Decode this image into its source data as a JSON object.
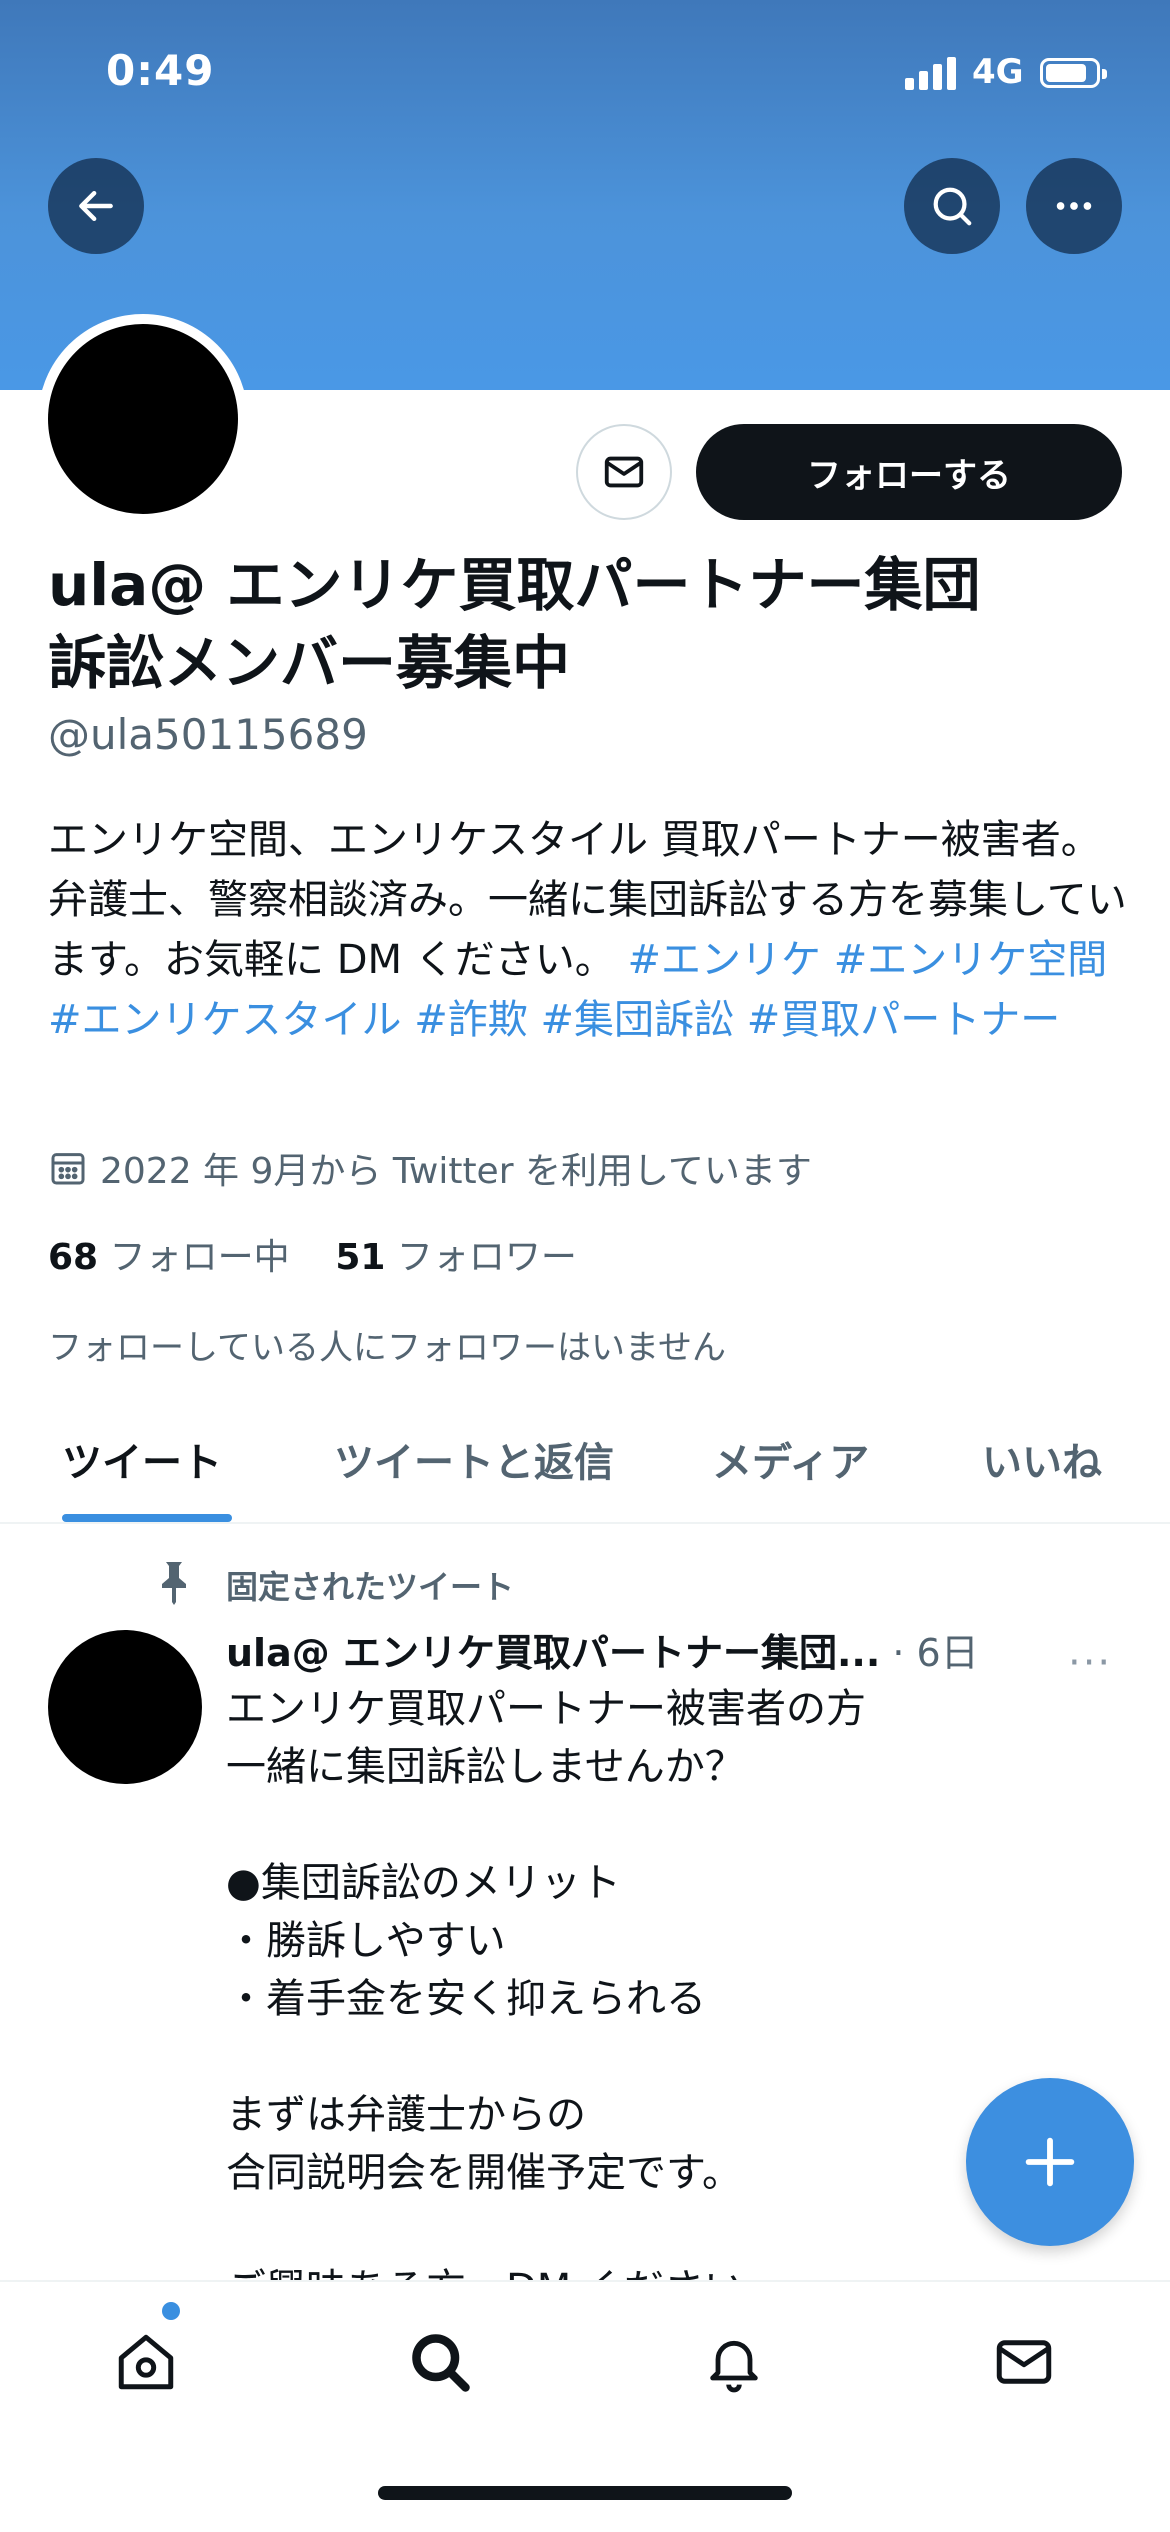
{
  "status_bar": {
    "time": "0:49",
    "network": "4G"
  },
  "header": {
    "back_icon": "arrow-left-icon",
    "search_icon": "search-icon",
    "more_icon": "more-horizontal-icon"
  },
  "profile": {
    "display_name": "ula@ エンリケ買取パートナー集団訴訟メンバー募集中",
    "handle": "@ula50115689",
    "bio_text": "エンリケ空間、エンリケスタイル 買取パートナー被害者。弁護士、警察相談済み。一緒に集団訴訟する方を募集しています。お気軽に DM ください。 ",
    "hashtags": [
      "#エンリケ",
      "#エンリケ空間",
      "#エンリケスタイル",
      "#詐欺",
      "#集団訴訟",
      "#買取パートナー"
    ],
    "joined": "2022 年 9月から Twitter を利用しています",
    "following_count": "68",
    "following_label": "フォロー中",
    "followers_count": "51",
    "followers_label": "フォロワー",
    "followers_note": "フォローしている人にフォロワーはいません",
    "follow_button": "フォローする",
    "dm_icon": "mail-icon"
  },
  "tabs": [
    {
      "label": "ツイート",
      "active": true
    },
    {
      "label": "ツイートと返信",
      "active": false
    },
    {
      "label": "メディア",
      "active": false
    },
    {
      "label": "いいね",
      "active": false
    }
  ],
  "pinned_tweet": {
    "pinned_label": "固定されたツイート",
    "name": "ula@ エンリケ買取パートナー集団...",
    "time": "· 6日",
    "more": "···",
    "body": "エンリケ買取パートナー被害者の方\n一緒に集団訴訟しませんか？\n\n●集団訴訟のメリット\n・勝訴しやすい\n・着手金を安く抑えられる\n\nまずは弁護士からの\n合同説明会を開催予定です。\n\nご興味ある方、DM ください"
  },
  "fab": {
    "icon": "plus-icon"
  },
  "bottom_nav": [
    {
      "name": "home-icon"
    },
    {
      "name": "search-icon"
    },
    {
      "name": "bell-icon"
    },
    {
      "name": "mail-icon"
    }
  ],
  "colors": {
    "accent": "#3a8fe0",
    "text": "#0f1419",
    "secondary": "#536471",
    "banner": "#4a98e6"
  }
}
